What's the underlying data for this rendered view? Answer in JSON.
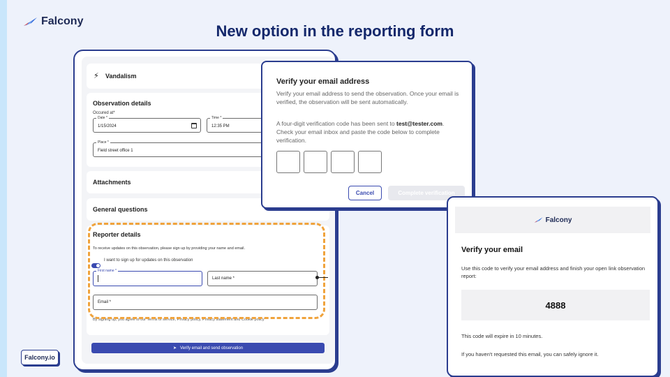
{
  "brand": {
    "name": "Falcony",
    "site": "Falcony.io"
  },
  "slide": {
    "title": "New option in the reporting form"
  },
  "form": {
    "observation_type": "Vandalism",
    "observation_details": {
      "title": "Observation details",
      "occurred_at_label": "Occured at*",
      "date_label": "Date *",
      "date_value": "1/15/2024",
      "time_label": "Time *",
      "time_value": "12:35 PM",
      "place_label": "Place *",
      "place_value": "Field street office 1"
    },
    "attachments_title": "Attachments",
    "general_questions_title": "General questions",
    "reporter": {
      "title": "Reporter details",
      "intro": "To receive updates on this observation, please sign up by providing your name and email.",
      "toggle_label": "I want to sign up for updates on this observation",
      "first_name_label": "First name *",
      "last_name_label": "Last name *",
      "email_label": "Email *",
      "terms": "By signing up, you agree to our Terms of service, Privacy policy, Privacy statement and Cookie policy"
    },
    "submit_label": "Verify email and send observation"
  },
  "modal": {
    "title": "Verify your email address",
    "para1": "Verify your email address to send the observation. Once your email is verified, the observation will be sent automatically.",
    "para2_prefix": "A four-digit verification code has been sent to",
    "email": "test@tester.com",
    "para2_suffix": ". Check your email inbox and paste the code below to complete verification.",
    "cancel_label": "Cancel",
    "complete_label": "Complete verification"
  },
  "email_preview": {
    "brand": "Falcony",
    "title": "Verify your email",
    "body": "Use this code to verify your email address and finish your open link observation report:",
    "code": "4888",
    "expiry": "This code will expire in 10 minutes.",
    "ignore": "If you haven't requested this email, you can safely ignore it."
  },
  "colors": {
    "navy": "#14286b",
    "accent": "#3a4ab0",
    "highlight": "#f0a33c"
  }
}
